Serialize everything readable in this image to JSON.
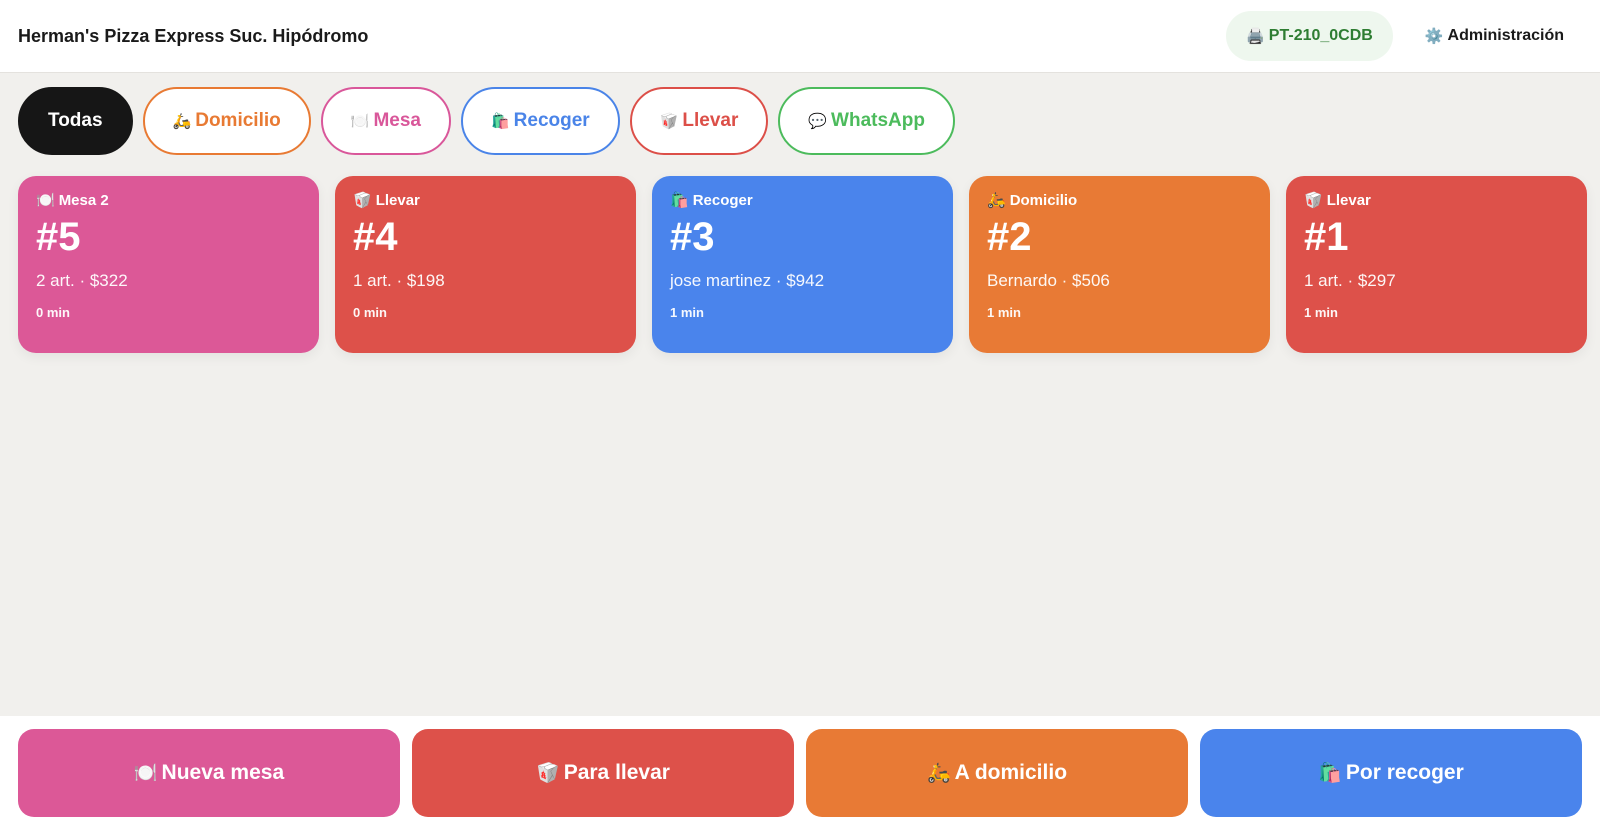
{
  "header": {
    "title": "Herman's Pizza Express Suc. Hipódromo",
    "printer": {
      "icon": "🖨️",
      "label": "PT-210_0CDB"
    },
    "admin": {
      "icon": "⚙️",
      "label": "Administración"
    }
  },
  "filters": [
    {
      "label": "Todas",
      "icon": "",
      "color": "#161616",
      "active": true
    },
    {
      "label": "Domicilio",
      "icon": "🛵",
      "color": "#e87a33",
      "active": false
    },
    {
      "label": "Mesa",
      "icon": "🍽️",
      "color": "#d9579a",
      "active": false
    },
    {
      "label": "Recoger",
      "icon": "🛍️",
      "color": "#4a84e8",
      "active": false
    },
    {
      "label": "Llevar",
      "icon": "🥡",
      "color": "#dc4f48",
      "active": false
    },
    {
      "label": "WhatsApp",
      "icon": "💬",
      "color": "#4cbb5c",
      "active": false
    }
  ],
  "orders": [
    {
      "type": "Mesa 2",
      "icon": "🍽️",
      "number": "#5",
      "detail": "2 art. · $322",
      "time": "0 min",
      "color": "#dc5897"
    },
    {
      "type": "Llevar",
      "icon": "🥡",
      "number": "#4",
      "detail": "1 art. · $198",
      "time": "0 min",
      "color": "#dd514a"
    },
    {
      "type": "Recoger",
      "icon": "🛍️",
      "number": "#3",
      "detail": "jose martinez · $942",
      "time": "1 min",
      "color": "#4a84ec"
    },
    {
      "type": "Domicilio",
      "icon": "🛵",
      "number": "#2",
      "detail": "Bernardo · $506",
      "time": "1 min",
      "color": "#e87a35"
    },
    {
      "type": "Llevar",
      "icon": "🥡",
      "number": "#1",
      "detail": "1 art. · $297",
      "time": "1 min",
      "color": "#dd514a"
    }
  ],
  "actions": [
    {
      "label": "Nueva mesa",
      "icon": "🍽️",
      "color": "#dc5897"
    },
    {
      "label": "Para llevar",
      "icon": "🥡",
      "color": "#dd514a"
    },
    {
      "label": "A domicilio",
      "icon": "🛵",
      "color": "#e87a35"
    },
    {
      "label": "Por recoger",
      "icon": "🛍️",
      "color": "#4a84ec"
    }
  ]
}
